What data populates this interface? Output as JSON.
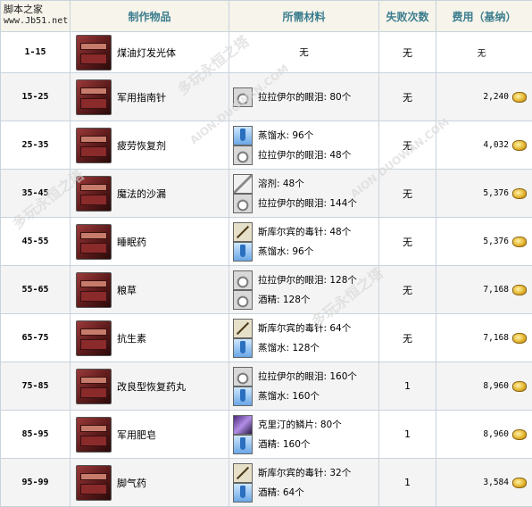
{
  "logo": {
    "name": "脚本之家",
    "site": "www.Jb51.net"
  },
  "header": {
    "item": "制作物品",
    "materials": "所需材料",
    "fail": "失败次数",
    "fee": "费用（基纳）"
  },
  "watermarks": [
    "多玩永恒之塔",
    "AION.DUOWAN.COM"
  ],
  "rows": [
    {
      "level": "1-15",
      "item": "煤油灯发光体",
      "materials_text": "无",
      "fail": "无",
      "fee": "无",
      "materials": []
    },
    {
      "level": "15-25",
      "item": "军用指南针",
      "fail": "无",
      "fee": "2,240",
      "materials": [
        {
          "icon": "bag-icon",
          "text": "拉拉伊尔的眼泪: 80个"
        }
      ]
    },
    {
      "level": "25-35",
      "item": "疲劳恢复剂",
      "fail": "无",
      "fee": "4,032",
      "materials": [
        {
          "icon": "vial-icon",
          "text": "蒸馏水: 96个"
        },
        {
          "icon": "bag-icon",
          "text": "拉拉伊尔的眼泪: 48个"
        }
      ]
    },
    {
      "level": "35-45",
      "item": "魔法的沙漏",
      "fail": "无",
      "fee": "5,376",
      "materials": [
        {
          "icon": "knife-icon",
          "text": "溶剂: 48个"
        },
        {
          "icon": "bag-icon",
          "text": "拉拉伊尔的眼泪: 144个"
        }
      ]
    },
    {
      "level": "45-55",
      "item": "睡眠药",
      "fail": "无",
      "fee": "5,376",
      "materials": [
        {
          "icon": "needle-icon",
          "text": "斯库尔宾的毒针: 48个"
        },
        {
          "icon": "vial-icon",
          "text": "蒸馏水: 96个"
        }
      ]
    },
    {
      "level": "55-65",
      "item": "粮草",
      "fail": "无",
      "fee": "7,168",
      "materials": [
        {
          "icon": "bag-icon",
          "text": "拉拉伊尔的眼泪: 128个"
        },
        {
          "icon": "bag-icon",
          "text": "酒精: 128个"
        }
      ]
    },
    {
      "level": "65-75",
      "item": "抗生素",
      "fail": "无",
      "fee": "7,168",
      "materials": [
        {
          "icon": "needle-icon",
          "text": "斯库尔宾的毒针: 64个"
        },
        {
          "icon": "vial-icon",
          "text": "蒸馏水: 128个"
        }
      ]
    },
    {
      "level": "75-85",
      "item": "改良型恢复药丸",
      "fail": "1",
      "fee": "8,960",
      "materials": [
        {
          "icon": "bag-icon",
          "text": "拉拉伊尔的眼泪: 160个"
        },
        {
          "icon": "vial-icon",
          "text": "蒸馏水: 160个"
        }
      ]
    },
    {
      "level": "85-95",
      "item": "军用肥皂",
      "fail": "1",
      "fee": "8,960",
      "materials": [
        {
          "icon": "flake-icon",
          "text": "克里汀的鳞片: 80个"
        },
        {
          "icon": "vial-icon",
          "text": "酒精: 160个"
        }
      ]
    },
    {
      "level": "95-99",
      "item": "脚气药",
      "fail": "1",
      "fee": "3,584",
      "materials": [
        {
          "icon": "needle-icon",
          "text": "斯库尔宾的毒针: 32个"
        },
        {
          "icon": "vial-icon",
          "text": "酒精: 64个"
        }
      ]
    }
  ]
}
